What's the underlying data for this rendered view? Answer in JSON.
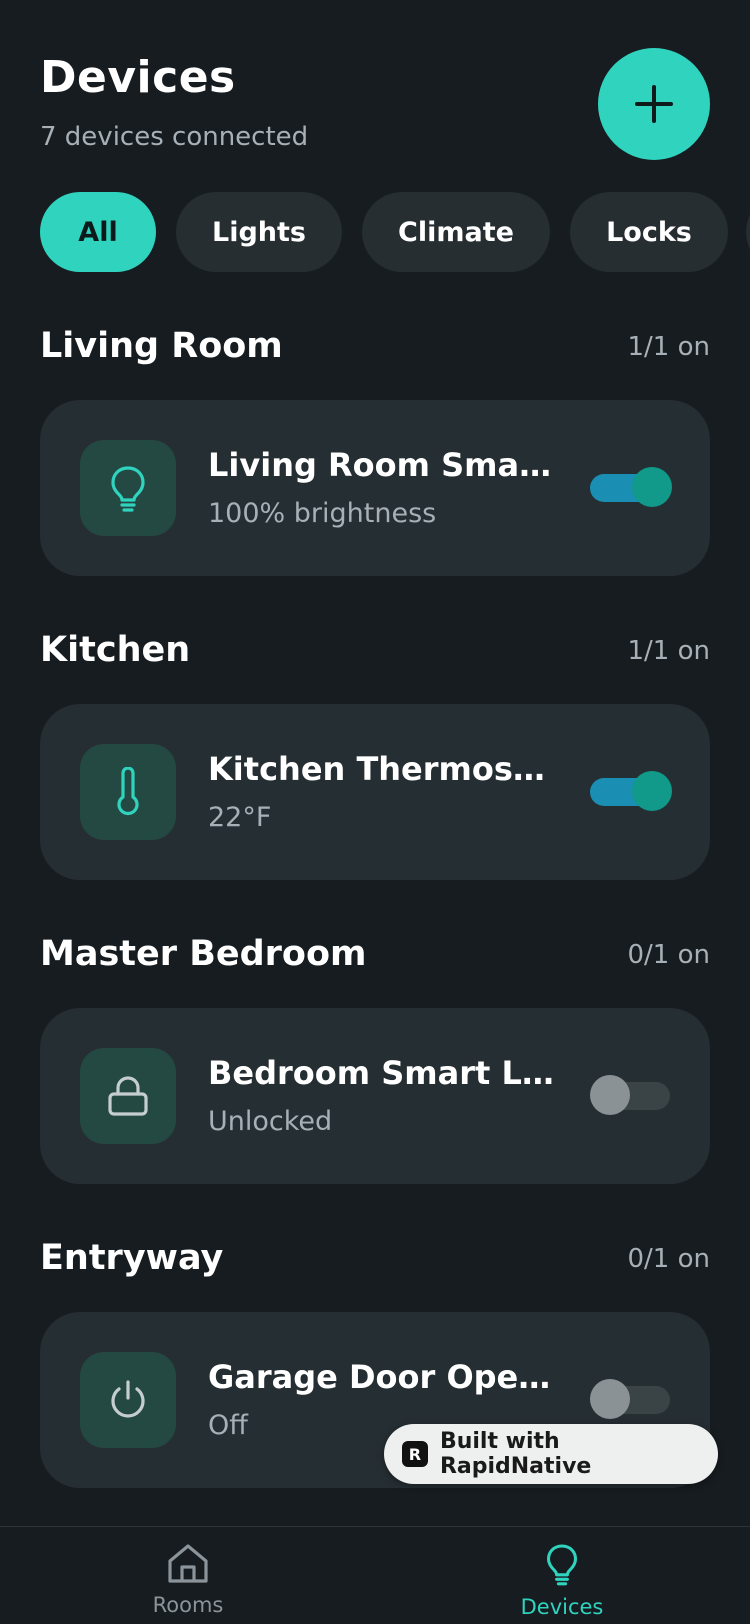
{
  "header": {
    "title": "Devices",
    "subtitle": "7 devices connected",
    "add_icon": "plus-icon"
  },
  "filters": [
    {
      "label": "All",
      "active": true
    },
    {
      "label": "Lights",
      "active": false
    },
    {
      "label": "Climate",
      "active": false
    },
    {
      "label": "Locks",
      "active": false
    }
  ],
  "sections": [
    {
      "title": "Living Room",
      "count": "1/1 on",
      "device": {
        "name": "Living Room Smart Light",
        "status": "100% brightness",
        "icon": "lightbulb-icon",
        "on": true
      }
    },
    {
      "title": "Kitchen",
      "count": "1/1 on",
      "device": {
        "name": "Kitchen Thermostat",
        "status": "22°F",
        "icon": "thermometer-icon",
        "on": true
      }
    },
    {
      "title": "Master Bedroom",
      "count": "0/1 on",
      "device": {
        "name": "Bedroom Smart Lock",
        "status": "Unlocked",
        "icon": "lock-icon",
        "on": false
      }
    },
    {
      "title": "Entryway",
      "count": "0/1 on",
      "device": {
        "name": "Garage Door Opener",
        "status": "Off",
        "icon": "power-icon",
        "on": false
      }
    }
  ],
  "badge": {
    "label": "Built with RapidNative"
  },
  "nav": {
    "rooms_label": "Rooms",
    "devices_label": "Devices"
  },
  "colors": {
    "accent": "#2fd3be",
    "background": "#161c20",
    "card": "#252e32",
    "toggle_on_track": "#1a8fb3",
    "toggle_on_thumb": "#11998a"
  }
}
